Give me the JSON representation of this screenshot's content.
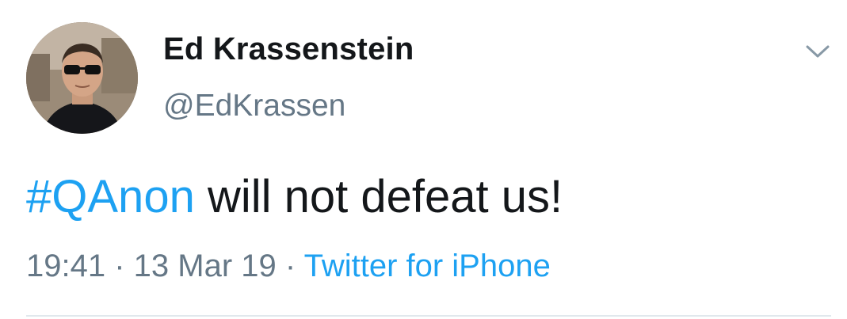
{
  "tweet": {
    "author_name": "Ed Krassenstein",
    "author_handle": "@EdKrassen",
    "hashtag": "#QAnon",
    "text_rest": " will not defeat us!",
    "time": "19:41",
    "separator": " · ",
    "date": "13 Mar 19",
    "source": "Twitter for iPhone"
  },
  "colors": {
    "link": "#1da1f2",
    "text": "#14171a",
    "secondary": "#657786"
  },
  "icons": {
    "menu": "chevron-down-icon"
  }
}
